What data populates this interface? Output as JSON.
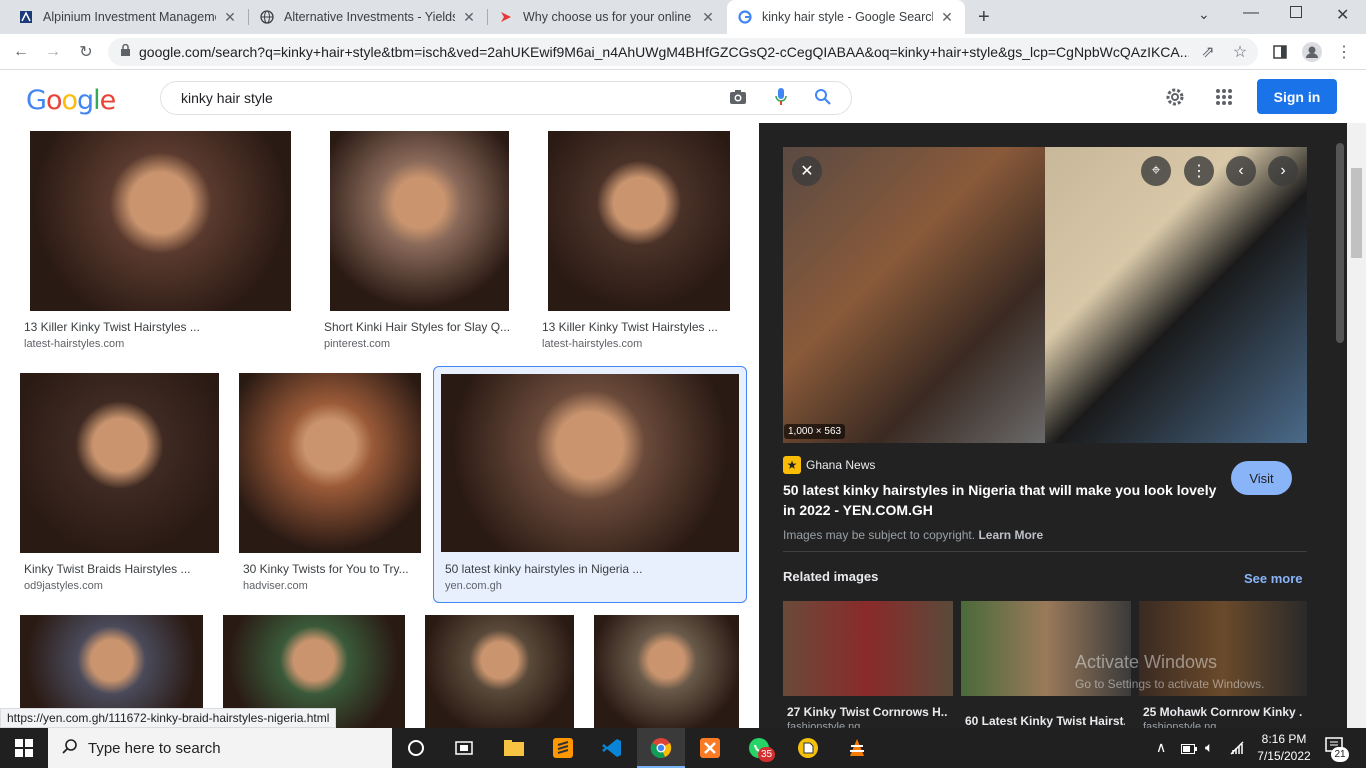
{
  "browser": {
    "tabs": [
      {
        "title": "Alpinium Investment Manageme",
        "icon": "alpinium-favicon",
        "active": false
      },
      {
        "title": "Alternative Investments - Yieldst",
        "icon": "globe-favicon",
        "active": false
      },
      {
        "title": "Why choose us for your online tr",
        "icon": "arrow-favicon",
        "active": false
      },
      {
        "title": "kinky hair style - Google Search",
        "icon": "google-favicon",
        "active": true
      }
    ],
    "url": "google.com/search?q=kinky+hair+style&tbm=isch&ved=2ahUKEwif9M6ai_n4AhUWgM4BHfGZCGsQ2-cCegQIABAA&oq=kinky+hair+style&gs_lcp=CgNpbWcQAzIKCA..."
  },
  "google": {
    "logo": "Google",
    "query": "kinky hair style",
    "signin_label": "Sign in"
  },
  "results": [
    {
      "caption": "13 Killer Kinky Twist Hairstyles ...",
      "source": "latest-hairstyles.com",
      "color": "#5a3a2e"
    },
    {
      "caption": "Short Kinki Hair Styles for Slay Q...",
      "source": "pinterest.com",
      "color": "#8a6a5a"
    },
    {
      "caption": "13 Killer Kinky Twist Hairstyles ...",
      "source": "latest-hairstyles.com",
      "color": "#4a3228"
    },
    {
      "caption": "Kinky Twist Braids Hairstyles ...",
      "source": "od9jastyles.com",
      "color": "#3e2a22"
    },
    {
      "caption": "30 Kinky Twists for You to Try...",
      "source": "hadviser.com",
      "color": "#9a5a38"
    },
    {
      "caption": "50 latest kinky hairstyles in Nigeria ...",
      "source": "yen.com.gh",
      "color": "#6a4a3a"
    },
    {
      "caption": "",
      "source": "",
      "color": "#4a4a5a"
    },
    {
      "caption": "",
      "source": "",
      "color": "#3a5a3a"
    },
    {
      "caption": "",
      "source": "",
      "color": "#5a4a3a"
    },
    {
      "caption": "",
      "source": "",
      "color": "#6a5a4a"
    }
  ],
  "preview": {
    "dimensions": "1,000 × 563",
    "site": "Ghana News",
    "title": "50 latest kinky hairstyles in Nigeria that will make you look lovely in 2022 - YEN.COM.GH",
    "visit_label": "Visit",
    "copyright": "Images may be subject to copyright.",
    "learn_more": "Learn More",
    "related_heading": "Related images",
    "see_more": "See more",
    "related": [
      {
        "caption": "27 Kinky Twist Cornrows H...",
        "source": "fashionstyle.ng"
      },
      {
        "caption": "60 Latest Kinky Twist Hairst...",
        "source": ""
      },
      {
        "caption": "25 Mohawk Cornrow Kinky ...",
        "source": "fashionstyle.ng"
      }
    ],
    "watermark_line1": "Activate Windows",
    "watermark_line2": "Go to Settings to activate Windows."
  },
  "status_url": "https://yen.com.gh/111672-kinky-braid-hairstyles-nigeria.html",
  "taskbar": {
    "search_placeholder": "Type here to search",
    "time": "8:16 PM",
    "date": "7/15/2022",
    "whatsapp_badge": "35",
    "notifications": "21"
  }
}
